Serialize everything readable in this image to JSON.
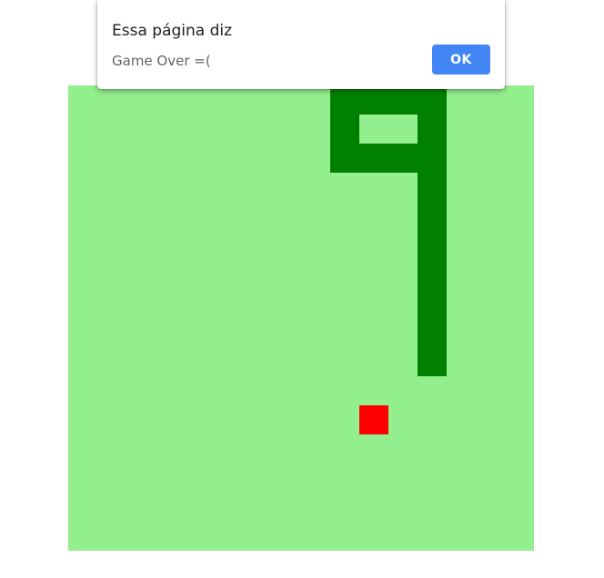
{
  "alert": {
    "title": "Essa página diz",
    "message": "Game Over =(",
    "ok_label": "OK"
  },
  "game": {
    "colors": {
      "board": "#93ee8d",
      "snake": "#008000",
      "food": "#ff0000"
    },
    "grid": {
      "columns": 16,
      "rows": 16
    },
    "snake": [
      [
        12,
        9
      ],
      [
        12,
        8
      ],
      [
        12,
        7
      ],
      [
        12,
        6
      ],
      [
        12,
        5
      ],
      [
        12,
        4
      ],
      [
        12,
        3
      ],
      [
        12,
        2
      ],
      [
        12,
        1
      ],
      [
        12,
        0
      ],
      [
        11,
        0
      ],
      [
        10,
        0
      ],
      [
        9,
        0
      ],
      [
        9,
        1
      ],
      [
        9,
        2
      ],
      [
        10,
        2
      ],
      [
        11,
        2
      ]
    ],
    "food": [
      10,
      11
    ]
  }
}
